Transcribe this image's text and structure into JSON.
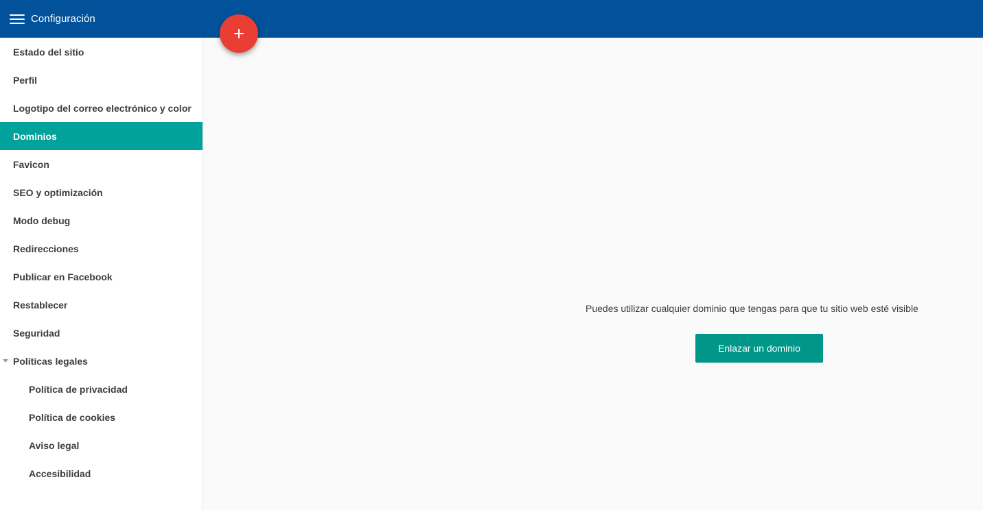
{
  "header": {
    "title": "Configuración",
    "menu_icon": "hamburger-menu-icon",
    "background_color": "#02529b"
  },
  "fab": {
    "icon": "plus-icon",
    "color": "#ea3e34"
  },
  "sidebar": {
    "items": [
      {
        "label": "Estado del sitio"
      },
      {
        "label": "Perfil"
      },
      {
        "label": "Logotipo del correo electrónico y color"
      },
      {
        "label": "Dominios",
        "active": true
      },
      {
        "label": "Favicon"
      },
      {
        "label": "SEO y optimización"
      },
      {
        "label": "Modo debug"
      },
      {
        "label": "Redirecciones"
      },
      {
        "label": "Publicar en Facebook"
      },
      {
        "label": "Restablecer"
      },
      {
        "label": "Seguridad"
      },
      {
        "label": "Políticas legales",
        "expanded": true
      }
    ],
    "sub_items": [
      {
        "label": "Política de privacidad"
      },
      {
        "label": "Política de cookies"
      },
      {
        "label": "Aviso legal"
      },
      {
        "label": "Accesibilidad"
      }
    ],
    "active_color": "#00a29a"
  },
  "main": {
    "empty_message": "Puedes utilizar cualquier dominio que tengas para que tu sitio web esté visible",
    "link_domain_button": "Enlazar un dominio",
    "button_color": "#009688"
  }
}
